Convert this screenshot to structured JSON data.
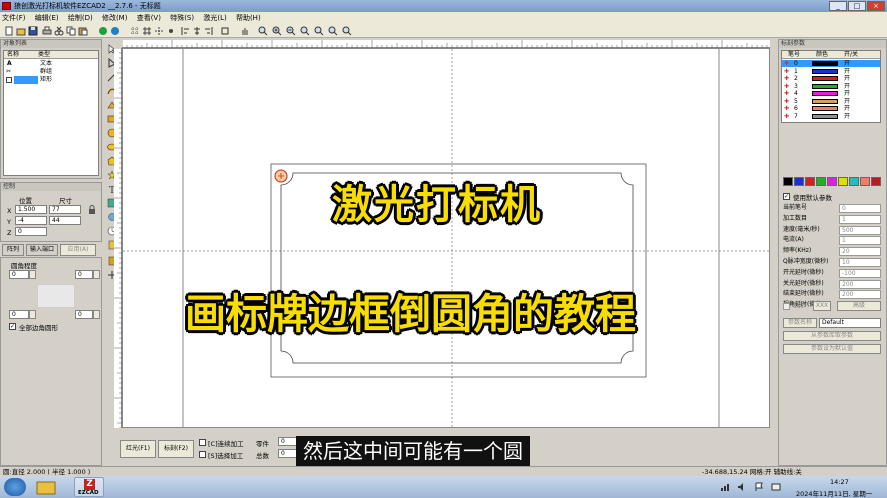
{
  "app": {
    "title": "狼创激光打标机软件EZCAD2 __2.7.6 - 无标题"
  },
  "window_buttons": [
    "_",
    "□",
    "×"
  ],
  "menu": [
    "文件(F)",
    "编辑(E)",
    "绘制(D)",
    "修改(M)",
    "查看(V)",
    "特殊(S)",
    "激光(L)",
    "帮助(H)"
  ],
  "object_list": {
    "title": "对象列表",
    "headers": [
      "名称",
      "类型"
    ],
    "rows": [
      {
        "name": "A",
        "type": "文本"
      },
      {
        "name": "",
        "type": "群组"
      },
      {
        "name": "",
        "type": "矩形"
      }
    ]
  },
  "position": {
    "title": "控制",
    "headers": [
      "位置",
      "尺寸"
    ],
    "x_label": "X",
    "x_pos": "1.500",
    "x_size": "77",
    "y_label": "Y",
    "y_pos": "-4",
    "y_size": "44",
    "z_label": "Z",
    "z_pos": "0"
  },
  "tabs": {
    "tab1": "阵列",
    "tab2": "输入端口",
    "apply": "应用(A)"
  },
  "rounding": {
    "label": "圆角程度",
    "v1": "0",
    "v2": "0",
    "v3": "0",
    "v4": "0",
    "all_corners": "全部边角圆形"
  },
  "canvas_overlay": {
    "line1": "激光打标机",
    "line2": "画标牌边框倒圆角的教程"
  },
  "subtitle": "然后这中间可能有一个圆",
  "bottom_panel": {
    "red_light": "红光(F1)",
    "mark": "标刻(F2)",
    "continuous": "[C]连续加工",
    "select_process": "[S]选择加工",
    "parts_label": "零件",
    "parts_value": "0",
    "total_label": "总数",
    "total_value": "0"
  },
  "status_bar": {
    "left": "圆:直径 2.000 ( 半径 1.000 )",
    "right": "-34.688,15.24 网格:开  辅助线:关"
  },
  "pen_panel": {
    "title": "标刻参数",
    "headers": [
      "笔号",
      "颜色",
      "开/关"
    ],
    "pens": [
      {
        "no": "0",
        "color": "#000000",
        "on": "开"
      },
      {
        "no": "1",
        "color": "#1a2fd8",
        "on": "开"
      },
      {
        "no": "2",
        "color": "#d42020",
        "on": "开"
      },
      {
        "no": "3",
        "color": "#20b020",
        "on": "开"
      },
      {
        "no": "4",
        "color": "#e020e0",
        "on": "开"
      },
      {
        "no": "5",
        "color": "#d4a05a",
        "on": "开"
      },
      {
        "no": "6",
        "color": "#f08060",
        "on": "开"
      },
      {
        "no": "7",
        "color": "#909090",
        "on": "开"
      }
    ],
    "swatches": [
      "#000000",
      "#1a2fd8",
      "#d42020",
      "#20b020",
      "#e020e0",
      "#e0e000",
      "#20c0c0",
      "#f08060",
      "#b02020"
    ],
    "use_default": "使用默认参数",
    "params": [
      {
        "label": "当前笔号",
        "value": "0"
      },
      {
        "label": "加工数目",
        "value": "1"
      },
      {
        "label": "速度(毫米/秒)",
        "value": "500"
      },
      {
        "label": "电流(A)",
        "value": "1"
      },
      {
        "label": "频率(KHz)",
        "value": "20"
      },
      {
        "label": "Q脉冲宽度(微秒)",
        "value": "10"
      },
      {
        "label": "开光延时(微秒)",
        "value": "-100"
      },
      {
        "label": "关光延时(微秒)",
        "value": "200"
      },
      {
        "label": "结束延时(微秒)",
        "value": "200"
      },
      {
        "label": "拐角延时(微秒)",
        "value": "100"
      }
    ],
    "cw_label": "CW",
    "xxx_label": "XXX",
    "advanced": "高级",
    "param_name_label": "参数名称",
    "param_name_value": "Default",
    "load_param": "从参数库取参数",
    "set_default": "参数设为默认值"
  },
  "taskbar": {
    "time": "14:27",
    "date": "2024年11月11日, 星期一",
    "app_label": "EZCAD"
  }
}
